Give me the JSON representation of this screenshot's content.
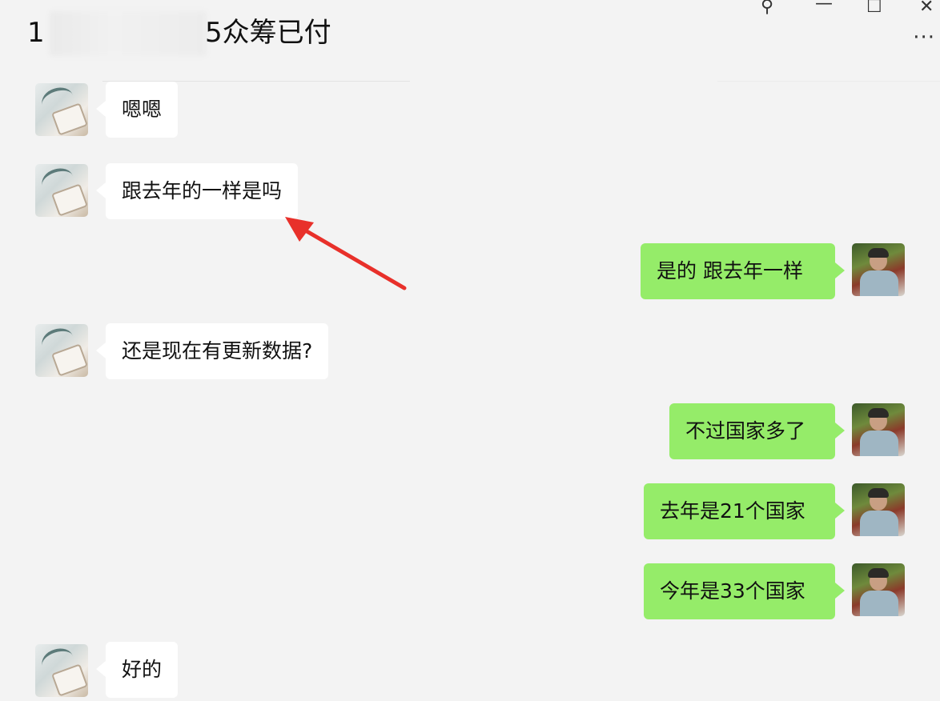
{
  "header": {
    "title_prefix": "1",
    "title_suffix": "5众筹已付",
    "more_label": "···"
  },
  "window_controls": {
    "pin_glyph": "⚲",
    "minimize_glyph": "—",
    "maximize_glyph": "☐",
    "close_glyph": "✕"
  },
  "messages": [
    {
      "side": "other",
      "text": "嗯嗯"
    },
    {
      "side": "other",
      "text": "跟去年的一样是吗"
    },
    {
      "side": "me",
      "text": "是的 跟去年一样"
    },
    {
      "side": "other",
      "text": "还是现在有更新数据?"
    },
    {
      "side": "me",
      "text": "不过国家多了"
    },
    {
      "side": "me",
      "text": "去年是21个国家"
    },
    {
      "side": "me",
      "text": "今年是33个国家"
    },
    {
      "side": "other",
      "text": "好的"
    }
  ],
  "colors": {
    "background": "#f3f3f3",
    "bubble_other": "#ffffff",
    "bubble_me": "#95ec69",
    "annotation_arrow": "#e8302a"
  },
  "icons": {
    "pin": "pin-icon",
    "minimize": "minimize-icon",
    "maximize": "maximize-icon",
    "close": "close-icon",
    "more": "more-icon"
  }
}
